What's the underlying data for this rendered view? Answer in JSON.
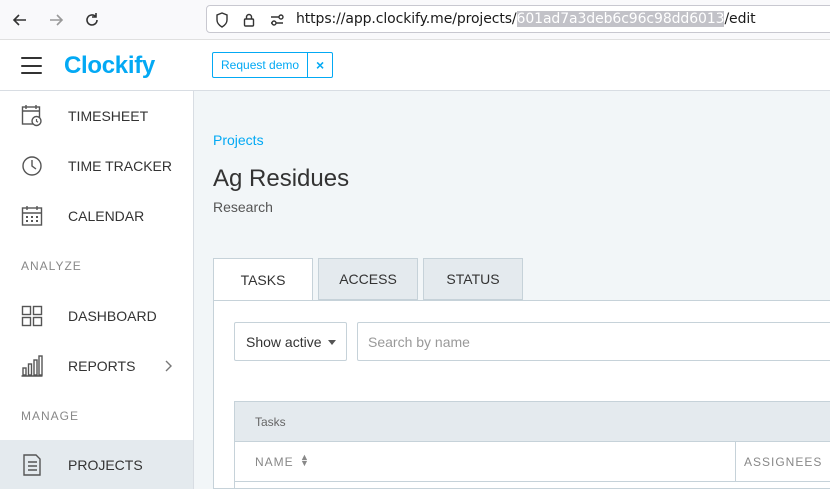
{
  "browser": {
    "url_prefix": "https://app.clockify.me/projects/",
    "url_highlight": "601ad7a3deb6c96c98dd6013",
    "url_suffix": "/edit"
  },
  "header": {
    "logo": "Clockify",
    "demo_label": "Request demo",
    "demo_close": "×"
  },
  "sidebar": {
    "items": [
      {
        "label": "TIMESHEET",
        "icon": "timesheet-icon"
      },
      {
        "label": "TIME TRACKER",
        "icon": "clock-icon"
      },
      {
        "label": "CALENDAR",
        "icon": "calendar-icon"
      },
      {
        "label": "DASHBOARD",
        "icon": "dashboard-icon"
      },
      {
        "label": "REPORTS",
        "icon": "reports-icon"
      },
      {
        "label": "PROJECTS",
        "icon": "projects-icon"
      }
    ],
    "sections": [
      "ANALYZE",
      "MANAGE"
    ]
  },
  "main": {
    "breadcrumb": "Projects",
    "title": "Ag Residues",
    "subtitle": "Research",
    "tabs": [
      "TASKS",
      "ACCESS",
      "STATUS"
    ],
    "filter_value": "Show active",
    "search_placeholder": "Search by name",
    "table": {
      "header": "Tasks",
      "col_name": "NAME",
      "col_assignees": "ASSIGNEES"
    }
  },
  "colors": {
    "accent": "#03a9f4",
    "sidebar_active": "#e4eaee",
    "main_bg": "#f2f6f8"
  }
}
